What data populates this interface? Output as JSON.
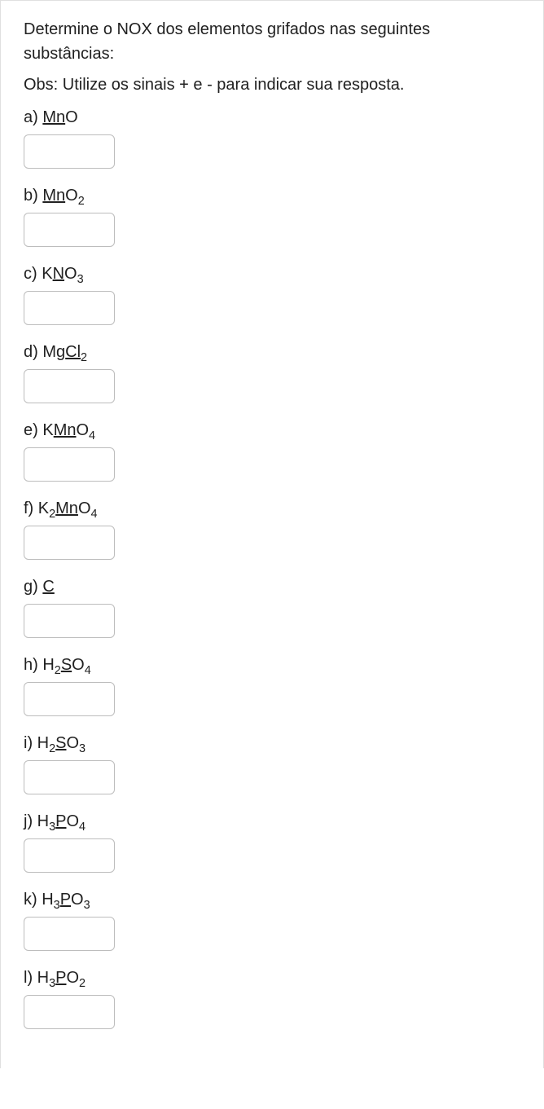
{
  "intro": "Determine o NOX dos elementos grifados nas seguintes substâncias:",
  "obs": "Obs: Utilize os sinais + e -  para indicar sua resposta.",
  "questions": {
    "a": {
      "letter": "a) ",
      "pre": "",
      "u": "Mn",
      "post": "O",
      "sub": ""
    },
    "b": {
      "letter": "b) ",
      "pre": "",
      "u": "Mn",
      "post": "O",
      "sub": "2"
    },
    "c": {
      "letter": "c) ",
      "pre": "K",
      "u": "N",
      "post": "O",
      "sub": "3"
    },
    "d": {
      "letter": "d) ",
      "pre": "Mg",
      "u": "Cl",
      "post": "",
      "sub": "2"
    },
    "e": {
      "letter": "e) ",
      "pre": "K",
      "u": "Mn",
      "post": "O",
      "sub": "4"
    },
    "f": {
      "letter": "f) ",
      "pre": "K",
      "presub": "2",
      "u": "Mn",
      "post": "O",
      "sub": "4"
    },
    "g": {
      "letter": "g) ",
      "pre": "",
      "u": "C",
      "post": "",
      "sub": ""
    },
    "h": {
      "letter": "h) ",
      "pre": "H",
      "presub": "2",
      "u": "S",
      "post": "O",
      "sub": "4"
    },
    "i": {
      "letter": "i) ",
      "pre": "H",
      "presub": "2",
      "u": "S",
      "post": "O",
      "sub": "3"
    },
    "j": {
      "letter": "j) ",
      "pre": "H",
      "presub": "3",
      "u": "P",
      "post": "O",
      "sub": "4"
    },
    "k": {
      "letter": "k) ",
      "pre": "H",
      "presub": "3",
      "u": "P",
      "post": "O",
      "sub": "3"
    },
    "l": {
      "letter": "l) ",
      "pre": "H",
      "presub": "3",
      "u": "P",
      "post": "O",
      "sub": "2"
    }
  }
}
